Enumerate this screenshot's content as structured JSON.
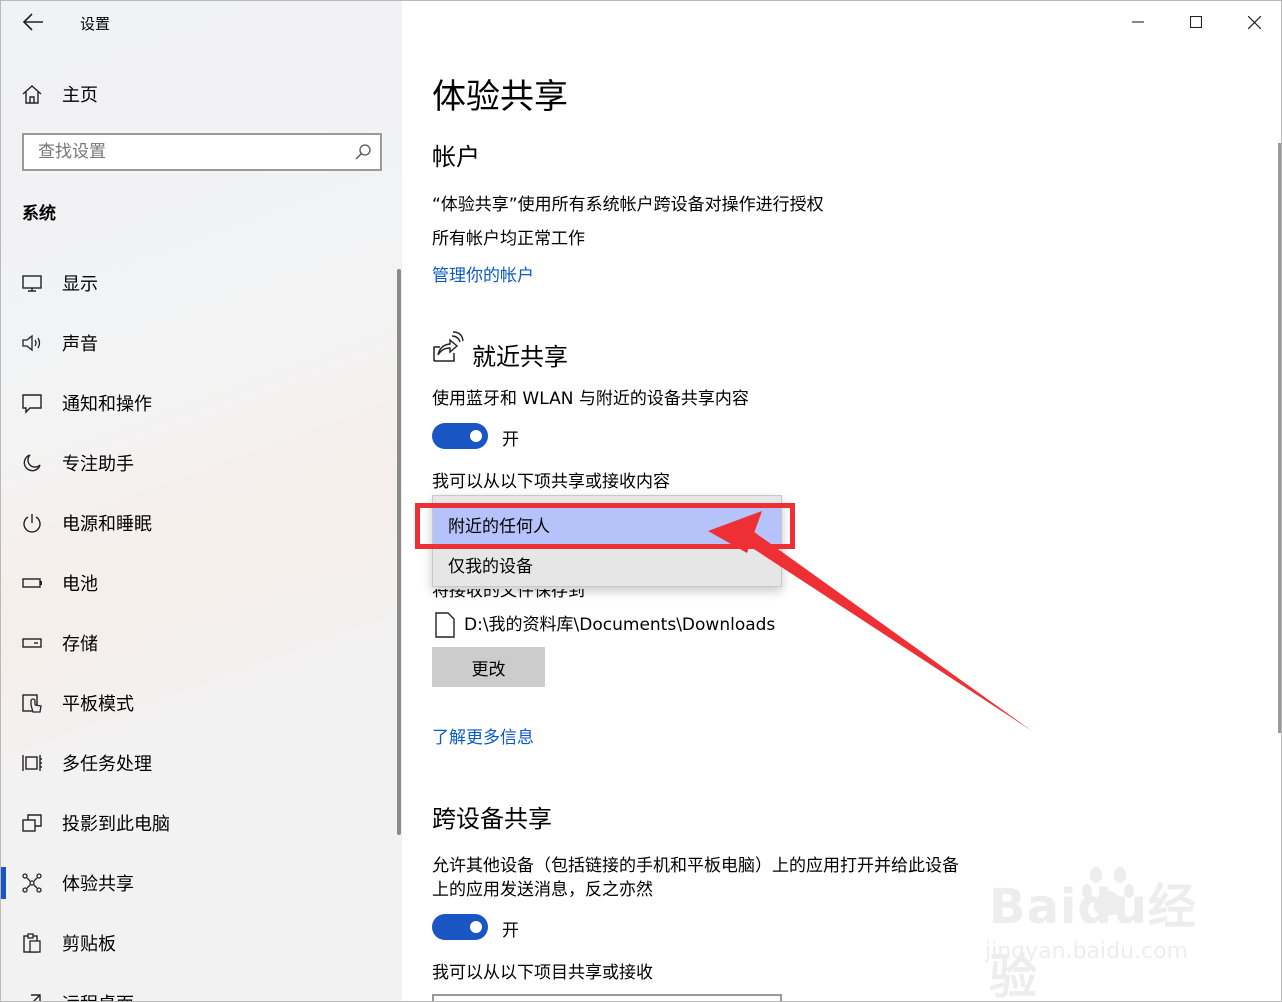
{
  "window": {
    "title": "设置"
  },
  "sidebar": {
    "home": "主页",
    "search_placeholder": "查找设置",
    "section": "系统",
    "items": [
      {
        "label": "显示",
        "icon": "monitor-icon"
      },
      {
        "label": "声音",
        "icon": "speaker-icon"
      },
      {
        "label": "通知和操作",
        "icon": "notification-icon"
      },
      {
        "label": "专注助手",
        "icon": "moon-icon"
      },
      {
        "label": "电源和睡眠",
        "icon": "power-icon"
      },
      {
        "label": "电池",
        "icon": "battery-icon"
      },
      {
        "label": "存储",
        "icon": "storage-icon"
      },
      {
        "label": "平板模式",
        "icon": "tablet-mode-icon"
      },
      {
        "label": "多任务处理",
        "icon": "multitasking-icon"
      },
      {
        "label": "投影到此电脑",
        "icon": "projection-icon"
      },
      {
        "label": "体验共享",
        "icon": "shared-experiences-icon",
        "active": true
      },
      {
        "label": "剪贴板",
        "icon": "clipboard-icon"
      },
      {
        "label": "远程桌面",
        "icon": "remote-desktop-icon"
      }
    ]
  },
  "main": {
    "title": "体验共享",
    "account": {
      "heading": "帐户",
      "line1": "“体验共享”使用所有系统帐户跨设备对操作进行授权",
      "line2": "所有帐户均正常工作",
      "link": "管理你的帐户"
    },
    "nearby": {
      "heading": "就近共享",
      "desc": "使用蓝牙和 WLAN 与附近的设备共享内容",
      "toggle_label": "开",
      "share_label": "我可以从以下项共享或接收内容",
      "dropdown_options": [
        "附近的任何人",
        "仅我的设备"
      ],
      "selected_option": "附近的任何人",
      "save_label_partial": "将接收的文件保存到",
      "path": "D:\\我的资料库\\Documents\\Downloads",
      "change_button": "更改",
      "learn_more": "了解更多信息"
    },
    "cross": {
      "heading": "跨设备共享",
      "desc_line1": "允许其他设备（包括链接的手机和平板电脑）上的应用打开并给此设备",
      "desc_line2": "上的应用发送消息，反之亦然",
      "toggle_label": "开",
      "share_label": "我可以从以下项目共享或接收"
    }
  },
  "watermark": {
    "brand": "Baidu经验",
    "sub": "jingyan.baidu.com"
  },
  "colors": {
    "accent": "#1a55c4",
    "link": "#0b5bc6",
    "highlight": "#ee2f33",
    "selected": "#b6c3fb"
  }
}
